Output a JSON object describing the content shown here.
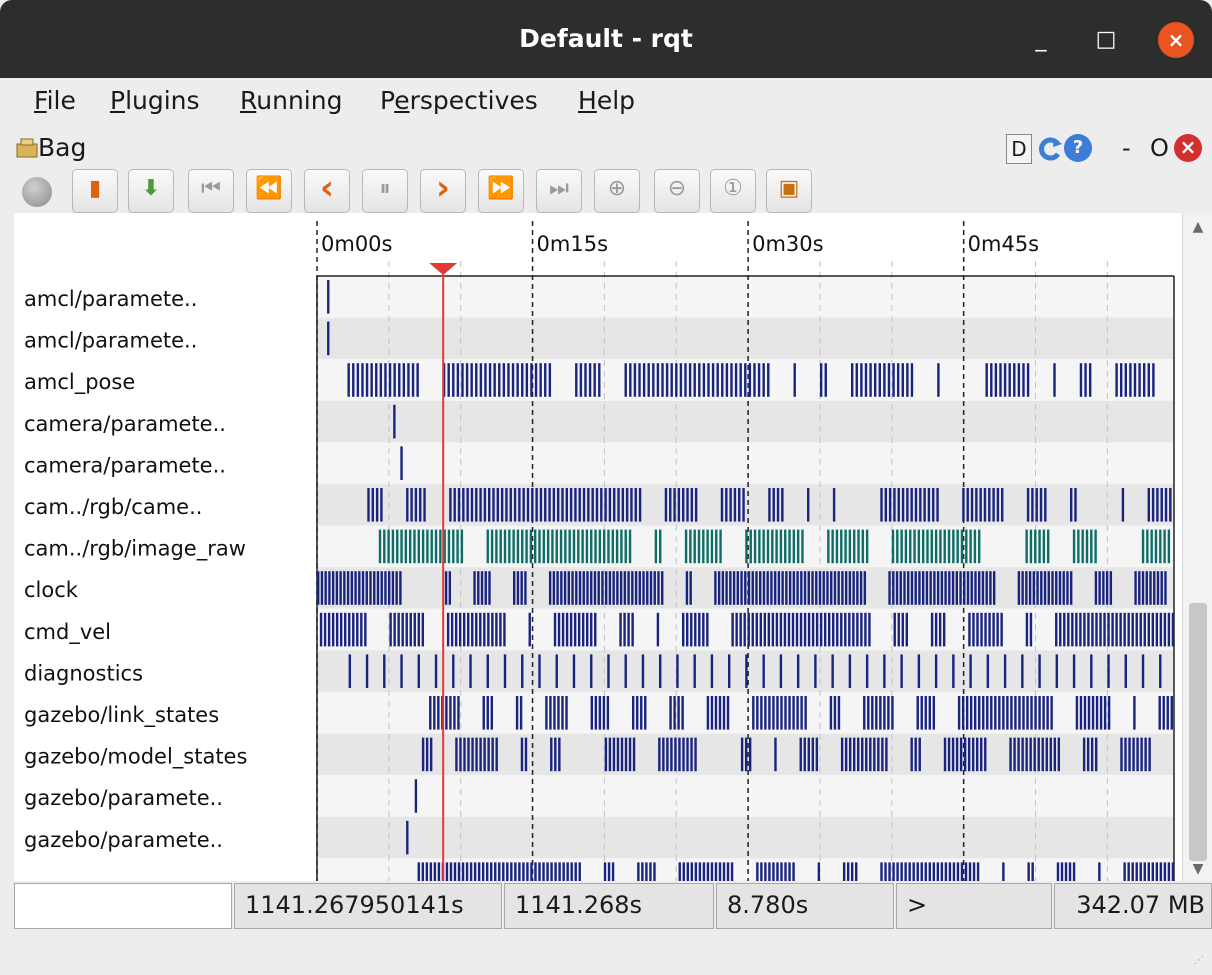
{
  "window": {
    "title": "Default - rqt",
    "minimize_glyph": "_",
    "maximize_glyph": "□",
    "close_glyph": "×"
  },
  "menubar": {
    "items": [
      {
        "mnemonic": "F",
        "rest": "ile"
      },
      {
        "mnemonic": "P",
        "rest": "lugins"
      },
      {
        "mnemonic": "R",
        "rest": "unning"
      },
      {
        "pre": "P",
        "mnemonic": "e",
        "rest": "rspectives"
      },
      {
        "mnemonic": "H",
        "rest": "elp"
      }
    ]
  },
  "dock": {
    "title": "Bag",
    "controls": {
      "d": "D",
      "help": "?",
      "minus": "-",
      "o": "O"
    }
  },
  "toolbar": {
    "buttons": [
      {
        "name": "record",
        "icon": "record-icon",
        "glyph": ""
      },
      {
        "name": "open",
        "icon": "open-folder-icon",
        "glyph": "▮"
      },
      {
        "name": "save",
        "icon": "save-download-icon",
        "glyph": "⬇"
      },
      {
        "name": "begin",
        "icon": "skip-to-begin-icon",
        "glyph": "⏮"
      },
      {
        "name": "rewind",
        "icon": "rewind-icon",
        "glyph": "⏪"
      },
      {
        "name": "back",
        "icon": "step-back-icon",
        "glyph": "‹"
      },
      {
        "name": "pause",
        "icon": "pause-icon",
        "glyph": "⏸"
      },
      {
        "name": "forward",
        "icon": "step-forward-icon",
        "glyph": "›"
      },
      {
        "name": "fast-forward",
        "icon": "fast-forward-icon",
        "glyph": "⏩"
      },
      {
        "name": "end",
        "icon": "skip-to-end-icon",
        "glyph": "⏭"
      },
      {
        "name": "zoom-in",
        "icon": "zoom-in-icon",
        "glyph": "⊕"
      },
      {
        "name": "zoom-out",
        "icon": "zoom-out-icon",
        "glyph": "⊖"
      },
      {
        "name": "zoom-reset",
        "icon": "zoom-reset-icon",
        "glyph": "①"
      },
      {
        "name": "thumbnails",
        "icon": "thumbnail-icon",
        "glyph": "▣"
      }
    ]
  },
  "timeline": {
    "ticks": [
      "0m00s",
      "0m15s",
      "0m30s",
      "0m45s"
    ],
    "topics": [
      "amcl/paramete..",
      "amcl/paramete..",
      "amcl_pose",
      "camera/paramete..",
      "camera/paramete..",
      "cam../rgb/came..",
      "cam../rgb/image_raw",
      "clock",
      "cmd_vel",
      "diagnostics",
      "gazebo/link_states",
      "gazebo/model_states",
      "gazebo/paramete..",
      "gazebo/paramete..",
      ""
    ],
    "playhead_seconds": 8.78,
    "colors": {
      "message": "#1a237e",
      "image": "#0e6e66",
      "playhead": "#e53935",
      "row_even": "#f5f5f5",
      "row_odd": "#e6e6e6"
    }
  },
  "statusbar": {
    "blank": "",
    "stamp": "1141.267950141s",
    "time": "1141.268s",
    "duration": "8.780s",
    "rate": ">",
    "size": "342.07 MB"
  }
}
